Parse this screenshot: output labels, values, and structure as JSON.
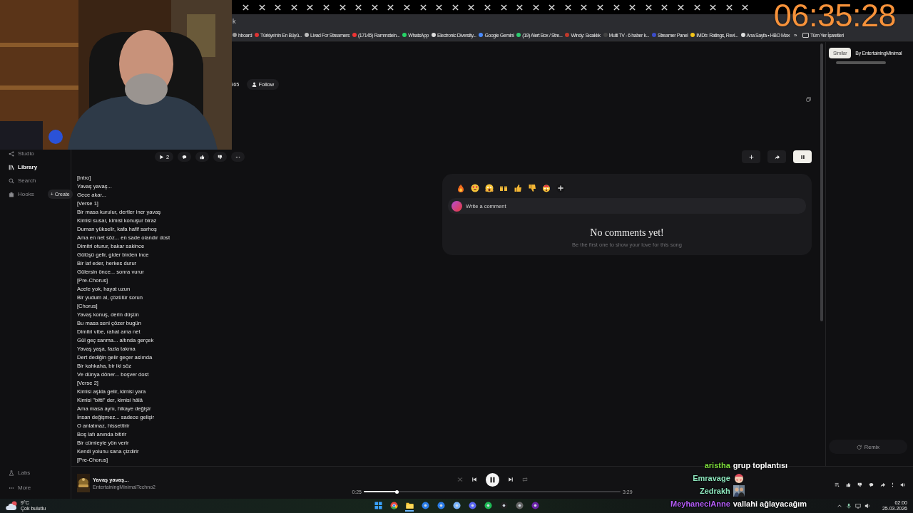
{
  "browser": {
    "address": "k",
    "bookmarks": [
      {
        "label": "hboard"
      },
      {
        "label": "Türkiye'nin En Büyü..."
      },
      {
        "label": "Livad For Streamers"
      },
      {
        "label": "(17145) Rammstein..."
      },
      {
        "label": "WhatsApp"
      },
      {
        "label": "Electronic Diversity..."
      },
      {
        "label": "Google Gemini"
      },
      {
        "label": "(19) Alert Box / Stre..."
      },
      {
        "label": "Windy: Sıcaklık"
      },
      {
        "label": "Multi TV - 6 haber k..."
      },
      {
        "label": "Streamer Panel"
      },
      {
        "label": "IMDb: Ratings, Revi..."
      },
      {
        "label": "Ana Sayfa • HBO Max"
      }
    ],
    "more_bookmarks": "»",
    "all_bookmarks": "Tüm Yer İşaretleri"
  },
  "sidebar": {
    "items": [
      {
        "label": "Studio",
        "selected": false
      },
      {
        "label": "Library",
        "selected": true
      },
      {
        "label": "Search",
        "selected": false
      },
      {
        "label": "Hooks",
        "selected": false
      }
    ],
    "create_button": "+ Create",
    "bottom_items": [
      {
        "label": "Labs"
      },
      {
        "label": "More"
      }
    ]
  },
  "song": {
    "count_fragment": "365",
    "follow_button": "Follow",
    "play_count": "2",
    "lyrics": [
      "[Intro]",
      "Yavaş yavaş...",
      "Gece akar...",
      "[Verse 1]",
      "Bir masa kurulur, dertler iner yavaş",
      "Kimisi susar, kimisi konuşur biraz",
      "Duman yükselir, kafa hafif sarhoş",
      "Ama en net söz... en sade olandır dost",
      "Dimitri oturur, bakar sakince",
      "Gülüşü gelir, gider birden ince",
      "Bir laf eder, herkes durur",
      "Gülersin önce... sonra vurur",
      "[Pre-Chorus]",
      "Acele yok, hayat uzun",
      "Bir yudum al, çözülür sorun",
      "[Chorus]",
      "Yavaş konuş, derin düşün",
      "Bu masa seni çözer bugün",
      "Dimitri vibe, rahat ama net",
      "Gül geç sanma... altında gerçek",
      "Yavaş yaşa, fazla takma",
      "Dert dediğin gelir geçer aslında",
      "Bir kahkaha, bir iki söz",
      "Ve dünya döner... boşver dost",
      "[Verse 2]",
      "Kimisi aşkla gelir, kimisi yara",
      "Kimisi \"bitti\" der, kimisi hâlâ",
      "Ama masa aynı, hikaye değişir",
      "İnsan değişmez... sadece gelişir",
      "O anlatmaz, hissettirir",
      "Boş lafı anında bitirir",
      "Bir cümleyle yön verir",
      "Kendi yolunu sana çizdirir",
      "[Pre-Chorus]"
    ]
  },
  "comments": {
    "placeholder": "Write a comment",
    "empty_title": "No comments yet!",
    "empty_text": "Be the first one to show your love for this song"
  },
  "right_panel": {
    "tabs": [
      {
        "label": "Similar",
        "selected": true
      },
      {
        "label": "By EntertainingMinimal",
        "selected": false
      }
    ],
    "remix_button": "Remix"
  },
  "player": {
    "title": "Yavaş yavaş...",
    "artist": "EntertainingMinimalTechno2",
    "elapsed": "0:25",
    "duration": "3:29",
    "level": 0.13,
    "playing": true
  },
  "taskbar": {
    "temperature": "9°C",
    "weather": "Çok bulutlu",
    "apps": [
      {
        "selected": false
      },
      {
        "selected": false
      },
      {
        "selected": true
      },
      {
        "selected": false
      },
      {
        "selected": false
      },
      {
        "selected": false
      },
      {
        "selected": false
      },
      {
        "selected": false
      },
      {
        "selected": false
      },
      {
        "selected": false
      },
      {
        "selected": false
      }
    ],
    "time": "02:00",
    "date": "25.03.2026"
  },
  "overlay": {
    "clock": "06:35:28",
    "chat": [
      {
        "user": "aristha",
        "color": "#7ede3c",
        "kind": "text",
        "message": "grup toplantısı"
      },
      {
        "user": "Emravage",
        "color": "#8de6bd",
        "kind": "emote"
      },
      {
        "user": "Zedrakh",
        "color": "#8de6bd"
      },
      {
        "user": "MeyhaneciAnne",
        "color": "#b25cf5",
        "kind": "text",
        "message": "vallahi ağlayacağım"
      }
    ]
  }
}
